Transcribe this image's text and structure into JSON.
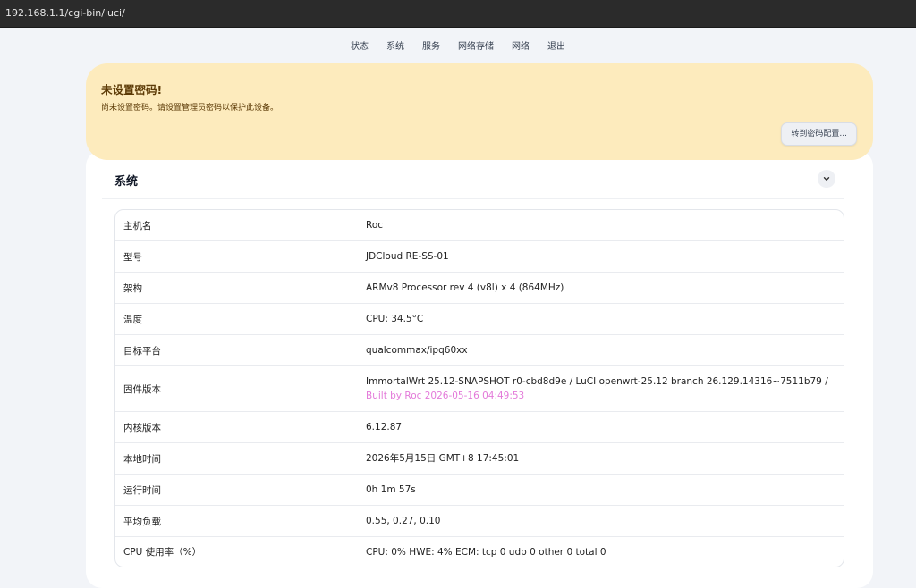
{
  "browser": {
    "url": "192.168.1.1/cgi-bin/luci/"
  },
  "nav": {
    "items": [
      {
        "label": "状态"
      },
      {
        "label": "系统"
      },
      {
        "label": "服务"
      },
      {
        "label": "网络存储"
      },
      {
        "label": "网络"
      },
      {
        "label": "退出"
      }
    ]
  },
  "alert": {
    "title": "未设置密码!",
    "message": "尚未设置密码。请设置管理员密码以保护此设备。",
    "button_label": "转到密码配置..."
  },
  "system": {
    "title": "系统",
    "collapse_icon": "chevron-down-icon",
    "rows": [
      {
        "key": "主机名",
        "value": "Roc"
      },
      {
        "key": "型号",
        "value": "JDCloud RE-SS-01"
      },
      {
        "key": "架构",
        "value": "ARMv8 Processor rev 4 (v8l) x 4 (864MHz)"
      },
      {
        "key": "温度",
        "value": "CPU: 34.5°C"
      },
      {
        "key": "目标平台",
        "value": "qualcommax/ipq60xx"
      },
      {
        "key": "固件版本",
        "value": "ImmortalWrt 25.12-SNAPSHOT r0-cbd8d9e / LuCI openwrt-25.12 branch 26.129.14316~7511b79 / ",
        "value_link": "Built by Roc 2026-05-16 04:49:53"
      },
      {
        "key": "内核版本",
        "value": "6.12.87"
      },
      {
        "key": "本地时间",
        "value": "2026年5月15日 GMT+8 17:45:01"
      },
      {
        "key": "运行时间",
        "value": "0h 1m 57s"
      },
      {
        "key": "平均负载",
        "value": "0.55, 0.27, 0.10"
      },
      {
        "key": "CPU 使用率（%）",
        "value": "CPU: 0% HWE: 4% ECM: tcp 0 udp 0 other 0 total 0"
      }
    ]
  },
  "colors": {
    "alert_bg": "#fdebbd",
    "built_link": "#e37ad9",
    "page_bg": "#f2f4f8"
  }
}
